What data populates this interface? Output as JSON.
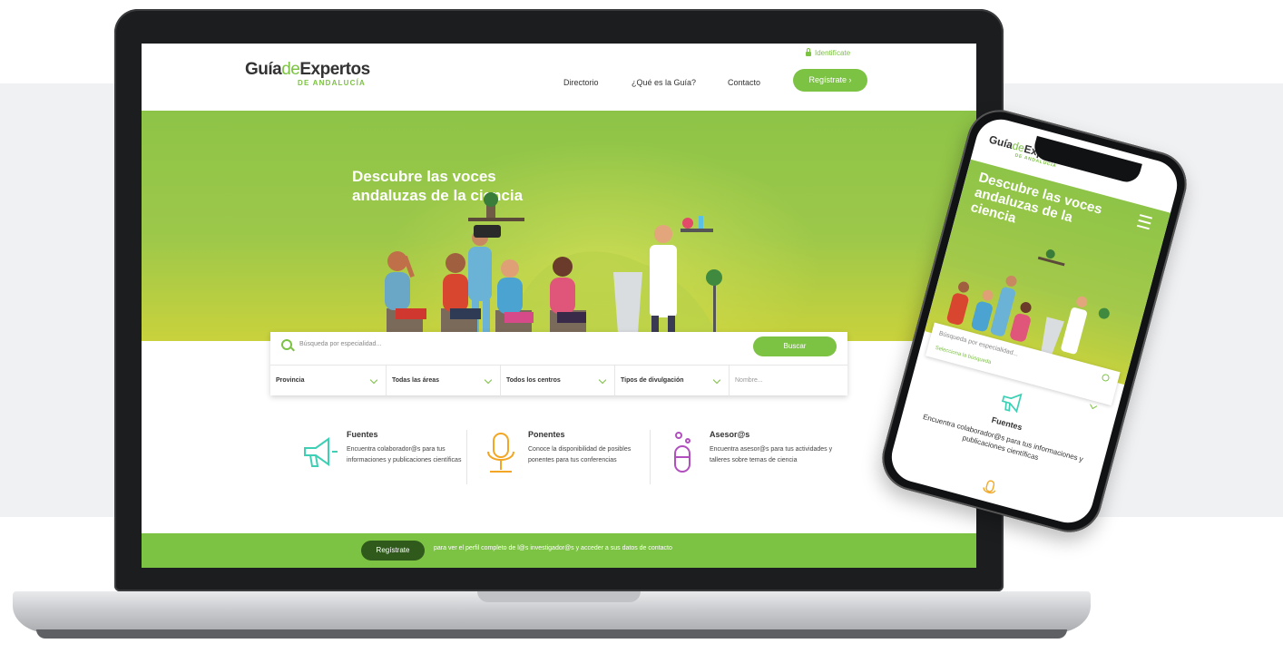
{
  "colors": {
    "brand_green": "#7cc243",
    "dark_green": "#2f5a1c",
    "accent_orange": "#f2a623",
    "accent_teal": "#3ed0b4",
    "accent_purple": "#b24fbf"
  },
  "laptop": {
    "logo": {
      "prefix": "Guía",
      "mid": "de",
      "suffix": "Expertos",
      "sub": "DE ANDALUCÍA"
    },
    "header": {
      "login_label": "Identifícate",
      "nav": [
        "Directorio",
        "¿Qué es la Guía?",
        "Contacto"
      ],
      "register_button": "Regístrate"
    },
    "hero": {
      "title": "Descubre las voces andaluzas de la ciencia"
    },
    "search": {
      "placeholder": "Búsqueda por especialidad...",
      "button": "Buscar",
      "filters": [
        "Provincia",
        "Todas las áreas",
        "Todos los centros",
        "Tipos de divulgación"
      ],
      "name_placeholder": "Nombre..."
    },
    "features": [
      {
        "title": "Fuentes",
        "desc": "Encuentra colaborador@s para tus informaciones y publicaciones científicas",
        "icon": "megaphone-icon"
      },
      {
        "title": "Ponentes",
        "desc": "Conoce la disponibilidad de posibles ponentes para tus conferencias",
        "icon": "microphone-icon"
      },
      {
        "title": "Asesor@s",
        "desc": "Encuentra asesor@s para tus actividades y talleres sobre temas de ciencia",
        "icon": "test-tube-icon"
      }
    ],
    "band": {
      "button": "Regístrate",
      "text": "para ver el perfil completo de l@s investigador@s y acceder a sus datos de contacto"
    }
  },
  "phone": {
    "logo": {
      "prefix": "Guía",
      "mid": "de",
      "suffix": "Expertos",
      "sub": "DE ANDALUCÍA"
    },
    "hero": {
      "title": "Descubre las voces andaluzas de la ciencia"
    },
    "search": {
      "placeholder": "Búsqueda por especialidad...",
      "filter": "Selecciona la búsqueda"
    },
    "feature": {
      "title": "Fuentes",
      "desc": "Encuentra colaborador@s para tus informaciones y publicaciones científicas"
    }
  }
}
